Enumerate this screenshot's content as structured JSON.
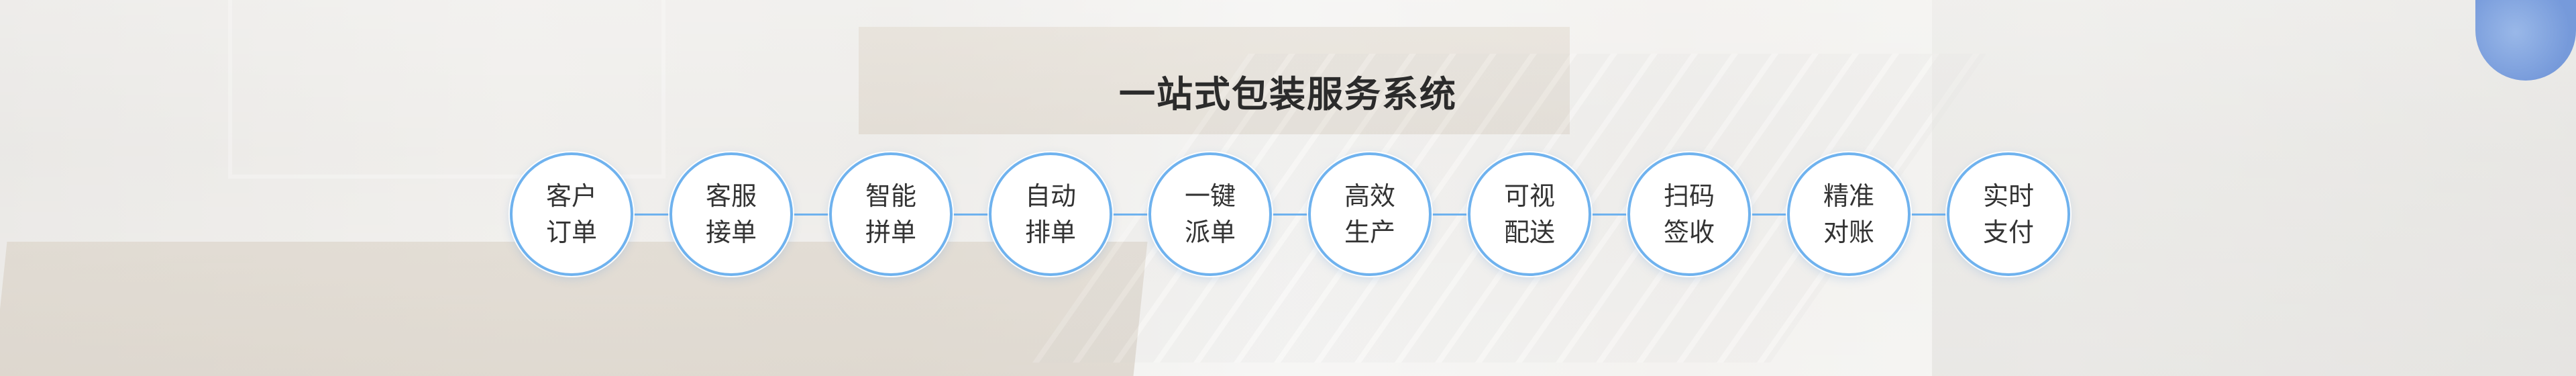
{
  "banner": {
    "title": "一站式包装服务系统"
  },
  "steps": [
    {
      "label": "客户\n订单"
    },
    {
      "label": "客服\n接单"
    },
    {
      "label": "智能\n拼单"
    },
    {
      "label": "自动\n排单"
    },
    {
      "label": "一键\n派单"
    },
    {
      "label": "高效\n生产"
    },
    {
      "label": "可视\n配送"
    },
    {
      "label": "扫码\n签收"
    },
    {
      "label": "精准\n对账"
    },
    {
      "label": "实时\n支付"
    }
  ],
  "colors": {
    "accent": "#6fb2ee",
    "title": "#2b2b2b",
    "label": "#333333",
    "circle_fill": "#ffffff"
  }
}
